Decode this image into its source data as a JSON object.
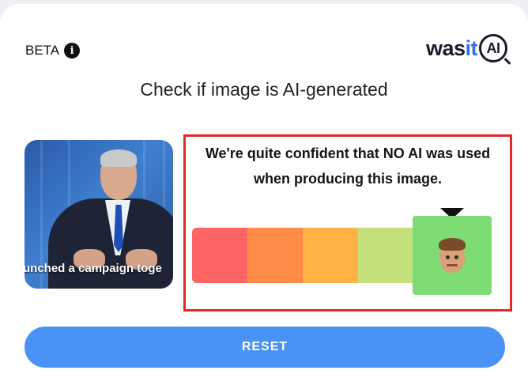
{
  "header": {
    "beta_label": "BETA",
    "info_icon": "info-icon",
    "logo": {
      "part1": "was",
      "part2": "it",
      "part3": "AI"
    },
    "title": "Check if image is AI-generated"
  },
  "image": {
    "caption": "unched a campaign toge"
  },
  "result": {
    "verdict_line1": "We're quite confident that NO AI was used",
    "verdict_line2": "when producing this image.",
    "scale_colors": [
      "#ff6464",
      "#ff8b47",
      "#ffb347",
      "#c4e07a",
      "#7ddc74"
    ],
    "selected_level": 5,
    "selected_icon": "human-face-emoji"
  },
  "actions": {
    "reset_label": "RESET"
  },
  "colors": {
    "accent": "#4b92f5",
    "highlight_border": "#e02a2a"
  }
}
